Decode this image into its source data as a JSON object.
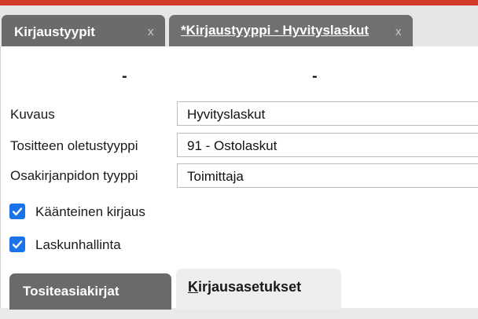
{
  "tabs": [
    {
      "label": "Kirjaustyypit",
      "close": "x"
    },
    {
      "label": "*Kirjaustyyppi - Hyvityslaskut",
      "close": "x"
    }
  ],
  "header": {
    "code": "-",
    "name": "-"
  },
  "form": {
    "description_label": "Kuvaus",
    "description_value": "Hyvityslaskut",
    "voucher_type_label": "Tositteen oletustyyppi",
    "voucher_type_value": "91 - Ostolaskut",
    "subledger_label": "Osakirjanpidon tyyppi",
    "subledger_value": "Toimittaja"
  },
  "checkboxes": [
    {
      "label": "Käänteinen kirjaus",
      "checked": true
    },
    {
      "label": "Laskunhallinta",
      "checked": true
    }
  ],
  "bottom_tabs": [
    {
      "label": "Tositeasiakirjat"
    },
    {
      "label": "Kirjausasetukset"
    }
  ],
  "colors": {
    "accent": "#1a73e8",
    "topbar": "#d23a2c"
  }
}
